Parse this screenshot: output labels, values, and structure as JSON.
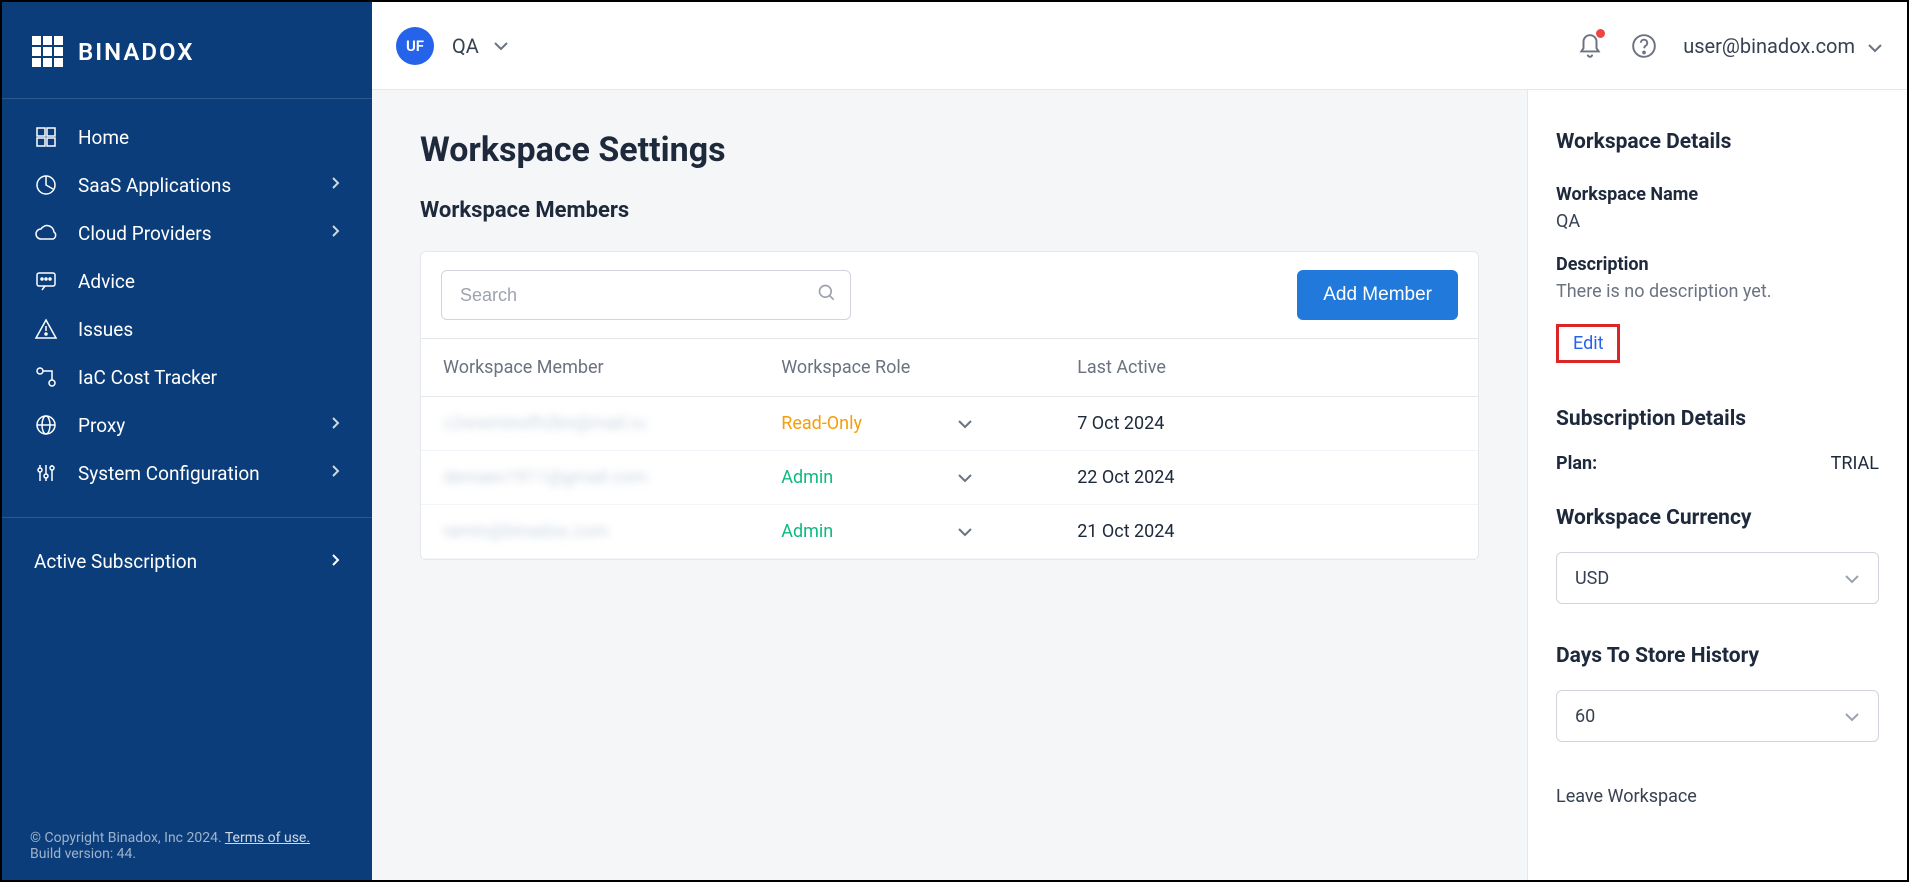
{
  "brand": "BINADOX",
  "sidebar": {
    "items": [
      {
        "label": "Home"
      },
      {
        "label": "SaaS Applications",
        "hasChildren": true
      },
      {
        "label": "Cloud Providers",
        "hasChildren": true
      },
      {
        "label": "Advice"
      },
      {
        "label": "Issues"
      },
      {
        "label": "IaC Cost Tracker"
      },
      {
        "label": "Proxy",
        "hasChildren": true
      },
      {
        "label": "System Configuration",
        "hasChildren": true
      }
    ],
    "subscription_label": "Active Subscription"
  },
  "footer": {
    "copyright": "© Copyright Binadox, Inc 2024. ",
    "terms": "Terms of use.",
    "build": "Build version: 44."
  },
  "topbar": {
    "avatar_initials": "UF",
    "workspace_name": "QA",
    "user_email": "user@binadox.com"
  },
  "page": {
    "title": "Workspace Settings",
    "section_title": "Workspace Members",
    "search_placeholder": "Search",
    "add_member_label": "Add Member"
  },
  "table": {
    "headers": {
      "member": "Workspace Member",
      "role": "Workspace Role",
      "last_active": "Last Active"
    },
    "rows": [
      {
        "member": "c2wwminxfh2bn@mail.ru",
        "role": "Read-Only",
        "role_class": "readonly",
        "last_active": "7 Oct 2024"
      },
      {
        "member": "demaev1911@gmail.com",
        "role": "Admin",
        "role_class": "admin",
        "last_active": "22 Oct 2024"
      },
      {
        "member": "ramin@binadox.com",
        "role": "Admin",
        "role_class": "admin",
        "last_active": "21 Oct 2024"
      }
    ]
  },
  "details": {
    "title": "Workspace Details",
    "name_label": "Workspace Name",
    "name_value": "QA",
    "desc_label": "Description",
    "desc_value": "There is no description yet.",
    "edit_label": "Edit",
    "subscription_title": "Subscription Details",
    "plan_label": "Plan:",
    "plan_value": "TRIAL",
    "currency_label": "Workspace Currency",
    "currency_value": "USD",
    "history_label": "Days To Store History",
    "history_value": "60",
    "leave_label": "Leave Workspace"
  }
}
